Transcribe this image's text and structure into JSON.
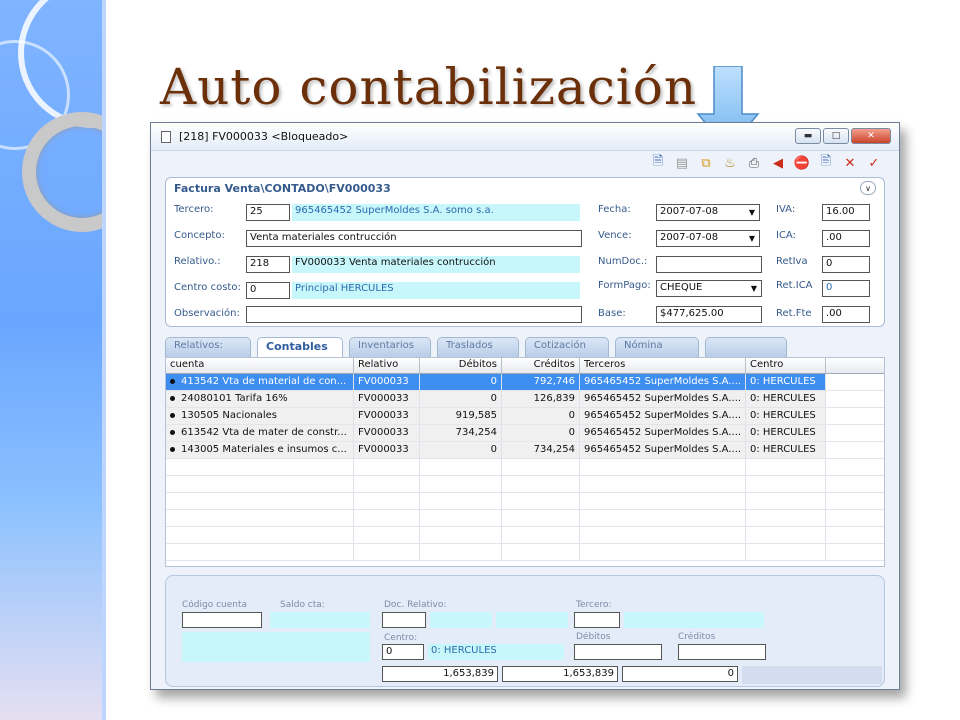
{
  "slide": {
    "title": "Auto contabilización"
  },
  "window": {
    "title": "[218] FV000033 <Bloqueado>"
  },
  "panel": {
    "title": "Factura Venta\\CONTADO\\FV000033",
    "tercero_label": "Tercero:",
    "tercero_code": "25",
    "tercero_name": "965465452 SuperMoldes S.A. somo s.a.",
    "concepto_label": "Concepto:",
    "concepto_value": "Venta materiales contrucción",
    "relativo_label": "Relativo.:",
    "relativo_code": "218",
    "relativo_desc": "FV000033 Venta materiales contrucción",
    "centro_label": "Centro costo:",
    "centro_code": "0",
    "centro_name": "Principal HERCULES",
    "observacion_label": "Observación:",
    "observacion_value": "",
    "fecha_label": "Fecha:",
    "fecha_value": "2007-07-08",
    "vence_label": "Vence:",
    "vence_value": "2007-07-08",
    "numdoc_label": "NumDoc.:",
    "numdoc_value": "",
    "formpago_label": "FormPago:",
    "formpago_value": "CHEQUE",
    "base_label": "Base:",
    "base_value": "$477,625.00",
    "iva_label": "IVA:",
    "iva_value": "16.00",
    "ica_label": "ICA:",
    "ica_value": ".00",
    "retiva_label": "RetIva",
    "retiva_value": "0",
    "retica_label": "Ret.ICA",
    "retica_value": "0",
    "retfte_label": "Ret.Fte",
    "retfte_value": ".00"
  },
  "tabs": [
    {
      "label": "Relativos:"
    },
    {
      "label": "Contables"
    },
    {
      "label": "Inventarios"
    },
    {
      "label": "Traslados"
    },
    {
      "label": "Cotización"
    },
    {
      "label": "Nómina"
    },
    {
      "label": ""
    }
  ],
  "grid": {
    "headers": [
      "cuenta",
      "Relativo",
      "Débitos",
      "Créditos",
      "Terceros",
      "Centro"
    ],
    "rows": [
      {
        "cuenta": "413542  Vta de material de con...",
        "relativo": "FV000033",
        "debitos": "0",
        "creditos": "792,746",
        "terceros": "965465452 SuperMoldes S.A....",
        "centro": "0: HERCULES"
      },
      {
        "cuenta": "24080101  Tarifa 16%",
        "relativo": "FV000033",
        "debitos": "0",
        "creditos": "126,839",
        "terceros": "965465452 SuperMoldes S.A....",
        "centro": "0: HERCULES"
      },
      {
        "cuenta": "130505  Nacionales",
        "relativo": "FV000033",
        "debitos": "919,585",
        "creditos": "0",
        "terceros": "965465452 SuperMoldes S.A....",
        "centro": "0: HERCULES"
      },
      {
        "cuenta": "613542  Vta de mater de constr...",
        "relativo": "FV000033",
        "debitos": "734,254",
        "creditos": "0",
        "terceros": "965465452 SuperMoldes S.A....",
        "centro": "0: HERCULES"
      },
      {
        "cuenta": "143005  Materiales e insumos c...",
        "relativo": "FV000033",
        "debitos": "0",
        "creditos": "734,254",
        "terceros": "965465452 SuperMoldes S.A....",
        "centro": "0: HERCULES"
      }
    ]
  },
  "bottom": {
    "codigo_label": "Código cuenta",
    "saldo_label": "Saldo cta:",
    "doc_label": "Doc. Relativo:",
    "tercero_label": "Tercero:",
    "centro_label": "Centro:",
    "centro_code": "0",
    "centro_name": "0: HERCULES",
    "debitos_label": "Débitos",
    "creditos_label": "Créditos",
    "total1": "1,653,839",
    "total2": "1,653,839",
    "total3": "0"
  },
  "colors": {
    "accent": "#3d8ef0",
    "readonly_bg": "#c8f7fb",
    "title": "#6b2f0a"
  }
}
